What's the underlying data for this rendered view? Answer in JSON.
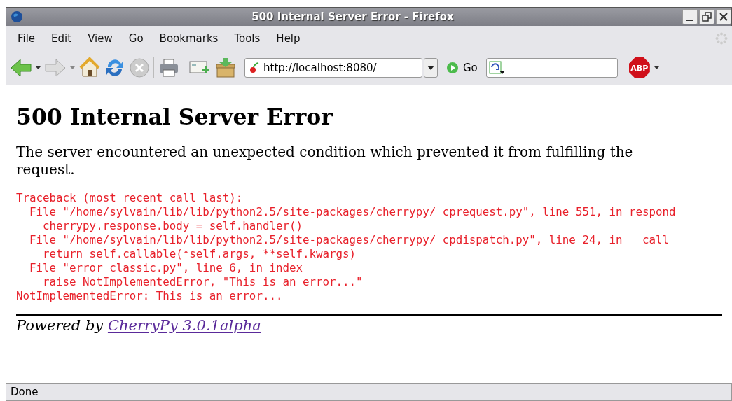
{
  "window": {
    "title": "500 Internal Server Error - Firefox"
  },
  "menu": [
    "File",
    "Edit",
    "View",
    "Go",
    "Bookmarks",
    "Tools",
    "Help"
  ],
  "toolbar": {
    "url": "http://localhost:8080/",
    "go_label": "Go",
    "adblock_label": "ABP"
  },
  "page": {
    "heading": "500 Internal Server Error",
    "message": "The server encountered an unexpected condition which prevented it from fulfilling the request.",
    "traceback": "Traceback (most recent call last):\n  File \"/home/sylvain/lib/lib/python2.5/site-packages/cherrypy/_cprequest.py\", line 551, in respond\n    cherrypy.response.body = self.handler()\n  File \"/home/sylvain/lib/lib/python2.5/site-packages/cherrypy/_cpdispatch.py\", line 24, in __call__\n    return self.callable(*self.args, **self.kwargs)\n  File \"error_classic.py\", line 6, in index\n    raise NotImplementedError, \"This is an error...\"\nNotImplementedError: This is an error...",
    "powered_by": "Powered by",
    "link": "CherryPy 3.0.1alpha"
  },
  "status_bar": "Done"
}
